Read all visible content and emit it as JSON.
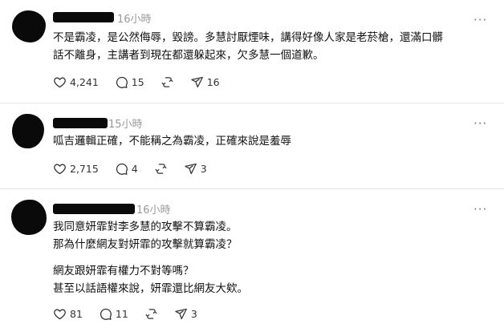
{
  "posts": [
    {
      "time": "16小時",
      "lines": [
        "不是霸凌，是公然侮辱，毀謗。多慧討厭煙味，講得好像人家是老菸槍，還滿口髒",
        "話不離身，主講者到現在都還躲起來，欠多慧一個道歉。"
      ],
      "likes": "4,241",
      "replies": "15",
      "shares": "16"
    },
    {
      "time": "15小時",
      "lines": [
        "呱吉邏輯正確，不能稱之為霸凌，正確來說是羞辱"
      ],
      "likes": "2,715",
      "replies": "4",
      "shares": "3"
    },
    {
      "time": "16小時",
      "lines": [
        "我同意妍霏對李多慧的攻擊不算霸凌。",
        "那為什麼網友對妍霏的攻擊就算霸凌？",
        "網友跟妍霏有權力不對等嗎？",
        "甚至以話語權來說，妍霏還比網友大欸。"
      ],
      "likes": "81",
      "replies": "11",
      "shares": "3"
    }
  ],
  "more_glyph": "···",
  "icons": [
    "heart-icon",
    "comment-icon",
    "repost-icon",
    "share-icon",
    "more-icon"
  ]
}
